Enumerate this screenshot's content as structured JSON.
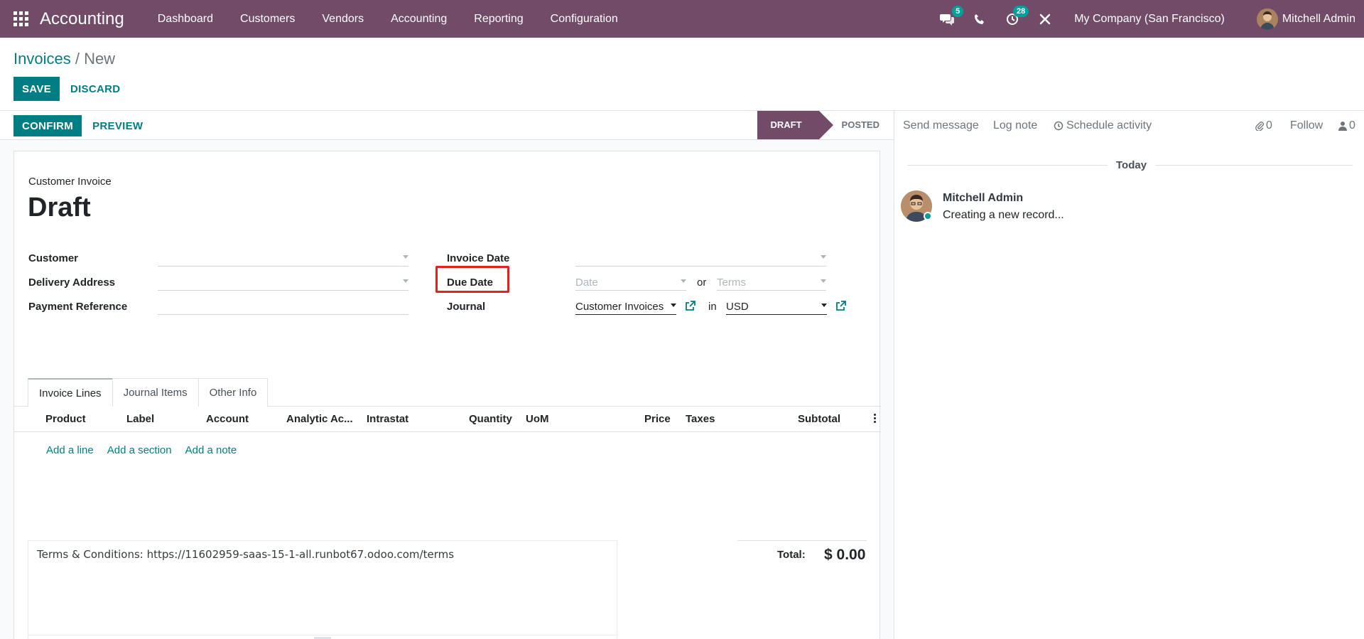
{
  "navbar": {
    "brand": "Accounting",
    "menu": [
      "Dashboard",
      "Customers",
      "Vendors",
      "Accounting",
      "Reporting",
      "Configuration"
    ],
    "messages_count": "5",
    "activities_count": "28",
    "company": "My Company (San Francisco)",
    "user": "Mitchell Admin",
    "icons": {
      "apps": "apps-grid-icon",
      "messages": "chat-bubbles-icon",
      "phone": "phone-icon",
      "activity": "clock-icon",
      "debug": "tools-icon"
    }
  },
  "breadcrumb": {
    "parent": "Invoices",
    "separator": " / ",
    "current": "New"
  },
  "control": {
    "save": "SAVE",
    "discard": "DISCARD"
  },
  "statusbar": {
    "confirm": "CONFIRM",
    "preview": "PREVIEW",
    "steps": [
      "DRAFT",
      "POSTED"
    ],
    "active_step": "DRAFT"
  },
  "form": {
    "doc_type": "Customer Invoice",
    "title": "Draft",
    "labels": {
      "customer": "Customer",
      "delivery_address": "Delivery Address",
      "payment_reference": "Payment Reference",
      "invoice_date": "Invoice Date",
      "due_date": "Due Date",
      "journal": "Journal"
    },
    "due_date": {
      "date_placeholder": "Date",
      "or": "or",
      "terms_placeholder": "Terms"
    },
    "journal": {
      "value": "Customer Invoices",
      "in": "in",
      "currency": "USD"
    }
  },
  "tabs": [
    "Invoice Lines",
    "Journal Items",
    "Other Info"
  ],
  "active_tab": "Invoice Lines",
  "table": {
    "columns": [
      "Product",
      "Label",
      "Account",
      "Analytic Ac...",
      "Intrastat",
      "Quantity",
      "UoM",
      "Price",
      "Taxes",
      "Subtotal"
    ],
    "add_links": [
      "Add a line",
      "Add a section",
      "Add a note"
    ]
  },
  "terms": {
    "text": "Terms & Conditions: https://11602959-saas-15-1-all.runbot67.odoo.com/terms"
  },
  "totals": {
    "label": "Total:",
    "value": "$ 0.00"
  },
  "chatter": {
    "send_message": "Send message",
    "log_note": "Log note",
    "schedule_activity": "Schedule activity",
    "attachments": "0",
    "follow": "Follow",
    "followers": "0",
    "date_separator": "Today",
    "message": {
      "author": "Mitchell Admin",
      "body": "Creating a new record..."
    }
  },
  "colors": {
    "brand": "#714b67",
    "primary": "#017e84",
    "highlight": "#e2231a",
    "online": "#00a09d"
  }
}
